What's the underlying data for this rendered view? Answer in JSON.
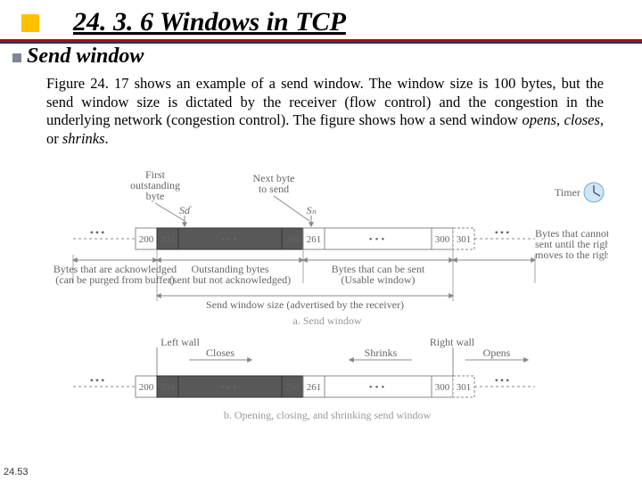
{
  "title": "24. 3. 6  Windows in TCP",
  "subheading": "Send window",
  "body_prefix": "Figure 24. 17 shows an example of a send window. The window size is 100 bytes, but the send window size is dictated by the receiver (flow control) and the congestion in the underlying network (congestion control). The figure shows how a send window ",
  "body_e1": "opens",
  "body_sep1": ", ",
  "body_e2": "closes",
  "body_sep2": ", or ",
  "body_e3": "shrinks",
  "body_suffix": ".",
  "page": "24.53",
  "fig": {
    "top_labels": {
      "first_outstanding_l1": "First",
      "first_outstanding_l2": "outstanding",
      "first_outstanding_l3": "byte",
      "next_l1": "Next byte",
      "next_l2": "to send",
      "Sf": "Sɗ",
      "Sn": "Sₙ",
      "timer": "Timer"
    },
    "cells": {
      "c200": "200",
      "c201": "201",
      "c260": "260",
      "c261": "261",
      "c300": "300",
      "c301": "301"
    },
    "groups": {
      "left_l1": "Bytes that are acknowledged",
      "left_l2": "(can be purged from buffer)",
      "mid_l1": "Outstanding bytes",
      "mid_l2": "(sent but not acknowledged)",
      "right_l1": "Bytes that can be sent",
      "right_l2": "(Usable window)",
      "far_l1": "Bytes that cannot be",
      "far_l2": "sent until the right edge",
      "far_l3": "moves to the right",
      "adv": "Send window size (advertised by the receiver)"
    },
    "caption_a": "a. Send window",
    "b_labels": {
      "left_wall": "Left wall",
      "right_wall": "Right wall",
      "closes": "Closes",
      "shrinks": "Shrinks",
      "opens": "Opens"
    },
    "caption_b": "b. Opening, closing, and shrinking send window"
  }
}
